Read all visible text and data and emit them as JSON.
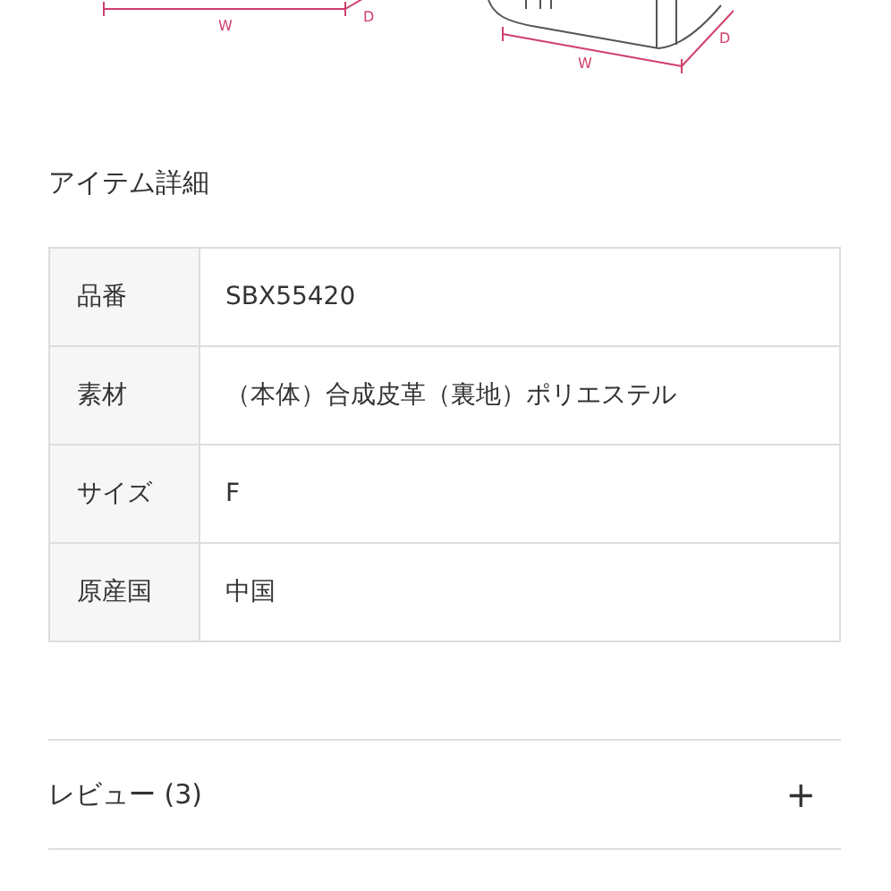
{
  "size_diagram": {
    "labels": [
      "W",
      "D",
      "W",
      "D"
    ]
  },
  "section_title": "アイテム詳細",
  "spec_table": {
    "rows": [
      {
        "label": "品番",
        "value": "SBX55420"
      },
      {
        "label": "素材",
        "value": "（本体）合成皮革（裏地）ポリエステル"
      },
      {
        "label": "サイズ",
        "value": "F"
      },
      {
        "label": "原産国",
        "value": "中国"
      }
    ]
  },
  "accordion": [
    {
      "title": "レビュー (3)",
      "icon": "+"
    }
  ]
}
